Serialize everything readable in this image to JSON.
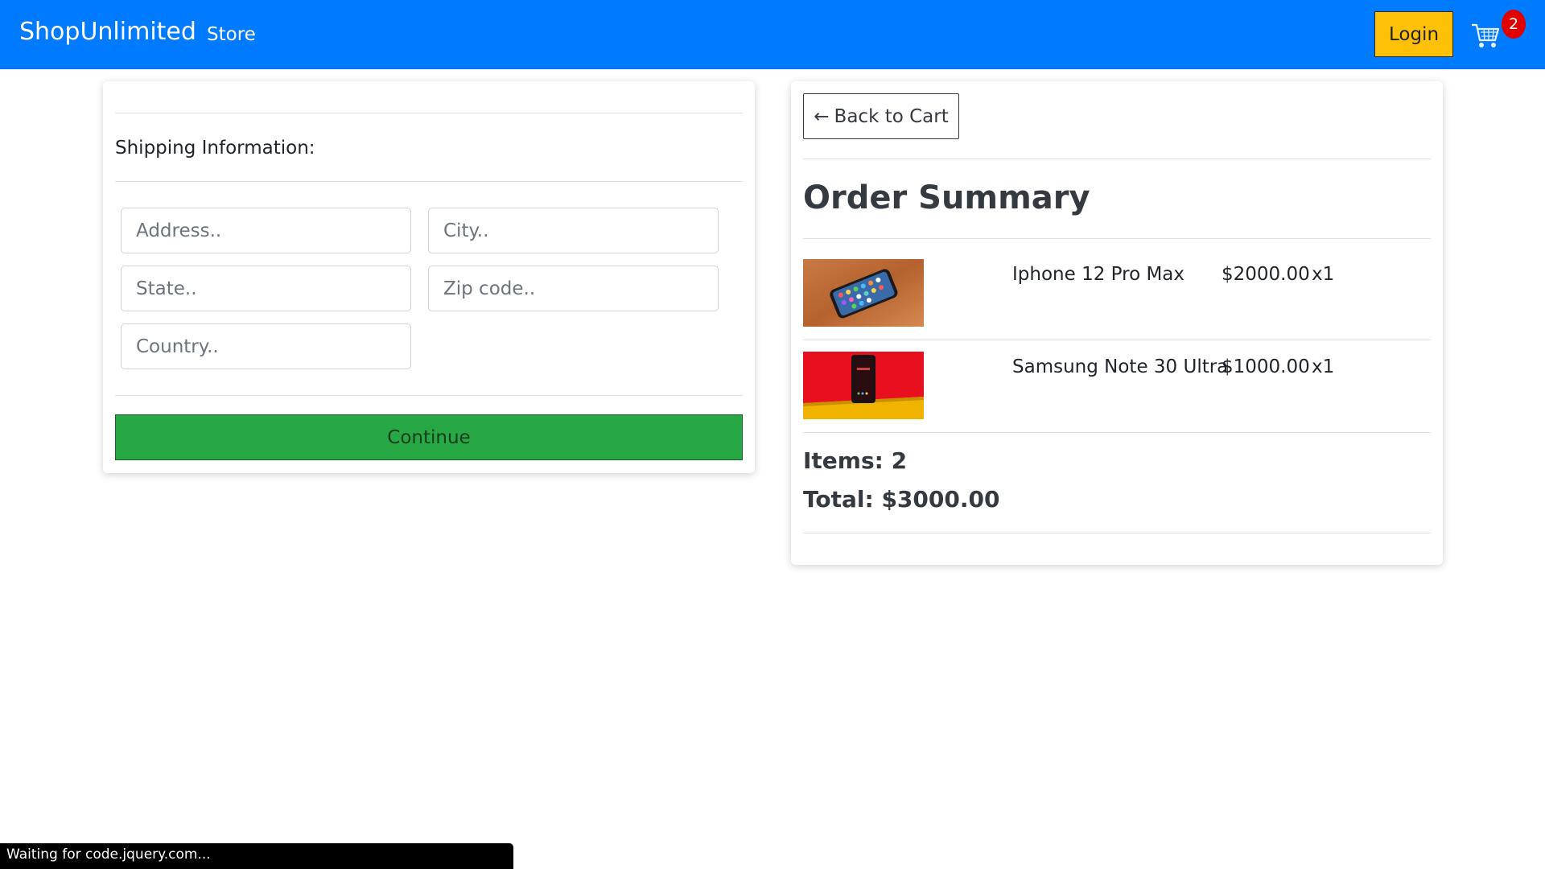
{
  "navbar": {
    "brand": "ShopUnlimited",
    "store_link": "Store",
    "login_label": "Login",
    "cart_count": "2",
    "brand_color": "#007bff"
  },
  "shipping": {
    "heading": "Shipping Information:",
    "address_placeholder": "Address..",
    "city_placeholder": "City..",
    "state_placeholder": "State..",
    "zip_placeholder": "Zip code..",
    "country_placeholder": "Country..",
    "continue_label": "Continue"
  },
  "summary": {
    "back_label": "Back to Cart",
    "title": "Order Summary",
    "items": [
      {
        "name": "Iphone 12 Pro Max",
        "price": "$2000.00",
        "qty": "x1"
      },
      {
        "name": "Samsung Note 30 Ultra",
        "price": "$1000.00",
        "qty": "x1"
      }
    ],
    "items_count": "Items: 2",
    "total": "Total: $3000.00"
  },
  "status_bar": {
    "text": "Waiting for code.jquery.com..."
  }
}
